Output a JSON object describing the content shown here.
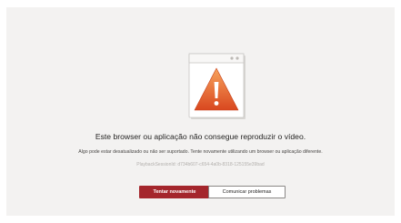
{
  "error": {
    "headline": "Este browser ou aplicação não consegue reproduzir o vídeo.",
    "detail": "Algo pode estar desatualizado ou não ser suportado. Tente novamente utilizando um browser ou aplicação diferente.",
    "session": "PlaybackSessionId: d734b607-c654-4a0b-8318-125155e39bad"
  },
  "actions": {
    "retry_label": "Tentar novamente",
    "report_label": "Comunicar problemas"
  },
  "icons": {
    "illustration": "browser-window-warning-icon"
  },
  "colors": {
    "primary": "#a4262c",
    "panel_background": "#f3f2f1",
    "warning_orange": "#e8622a"
  }
}
